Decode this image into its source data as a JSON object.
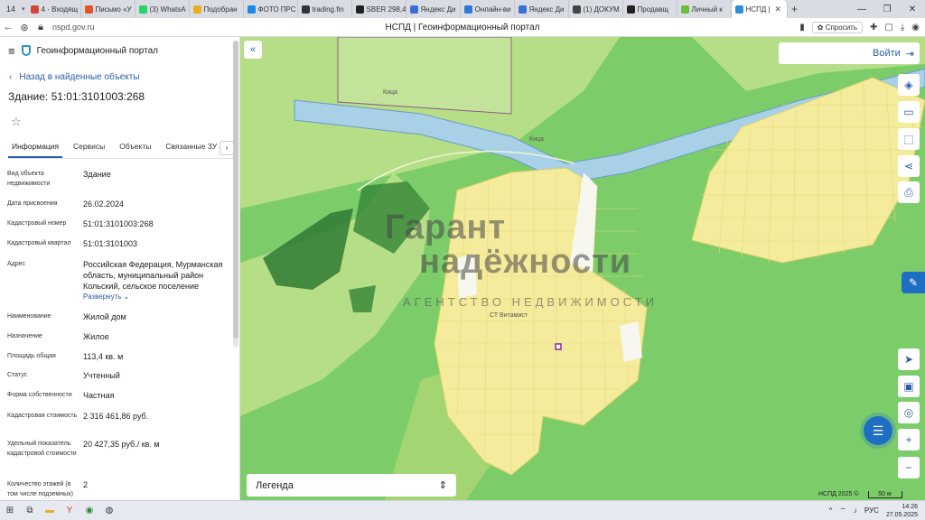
{
  "browser": {
    "tab_count": "14",
    "tabs": [
      {
        "label": "4 · Входящ",
        "color": "#d44638"
      },
      {
        "label": "Письмо «У",
        "color": "#e0552a"
      },
      {
        "label": "(3) WhatsA",
        "color": "#25d366"
      },
      {
        "label": "Подобран",
        "color": "#e8b020"
      },
      {
        "label": "ФОТО ПРС",
        "color": "#1e88e5"
      },
      {
        "label": "trading.fin",
        "color": "#333333"
      },
      {
        "label": "SBER 298,4",
        "color": "#222222"
      },
      {
        "label": "Яндекс Ди",
        "color": "#3b6fd8"
      },
      {
        "label": "Онлайн-ви",
        "color": "#2a7bd8"
      },
      {
        "label": "Яндекс Ди",
        "color": "#3b6fd8"
      },
      {
        "label": "(1) ДОКУМ",
        "color": "#444444"
      },
      {
        "label": "Продавщ",
        "color": "#222222"
      },
      {
        "label": "Личный к",
        "color": "#6cbf3c"
      },
      {
        "label": "НСПД |",
        "color": "#2a8fd8",
        "active": true
      }
    ],
    "url": "nspd.gov.ru",
    "page_title": "НСПД | Геоинформационный портал",
    "ask_label": "Спросить"
  },
  "panel": {
    "portal_title": "Геоинформационный портал",
    "back_label": "Назад в найденные объекты",
    "object_title": "Здание: 51:01:3101003:268",
    "tabs": [
      "Информация",
      "Сервисы",
      "Объекты",
      "Связанные ЗУ"
    ],
    "rows": [
      {
        "label": "Вид объекта недвижимости",
        "value": "Здание"
      },
      {
        "label": "Дата присвоения",
        "value": "26.02.2024"
      },
      {
        "label": "Кадастровый номер",
        "value": "51:01:3101003:268"
      },
      {
        "label": "Кадастровый квартал",
        "value": "51:01:3101003"
      },
      {
        "label": "Адрес",
        "value": "Российская Федерация, Мурманская область, муниципальный район Кольский, сельское поселение"
      },
      {
        "label": "Наименование",
        "value": "Жилой дом"
      },
      {
        "label": "Назначение",
        "value": "Жилое"
      },
      {
        "label": "Площадь общая",
        "value": "113,4 кв. м"
      },
      {
        "label": "Статус",
        "value": "Учтенный"
      },
      {
        "label": "Форма собственности",
        "value": "Частная"
      },
      {
        "label": "Кадастровая стоимость",
        "value": "2 316 461,86 руб."
      },
      {
        "label": "Удельный показатель кадастровой стоимости",
        "value": "20 427,35 руб./ кв. м"
      },
      {
        "label": "Количество этажей (в том числе подземных)",
        "value": "2"
      }
    ],
    "expand_label": "Развернуть"
  },
  "map": {
    "login_label": "Войти",
    "legend_label": "Легенда",
    "scale_label": "50 м",
    "copyright": "НСПД 2025 ©",
    "river_label_1": "Кица",
    "river_label_2": "Кица",
    "settlement_label": "СТ Витамист",
    "watermark": {
      "line1": "Гарант",
      "line2": "надёжности",
      "line3": "АГЕНТСТВО НЕДВИЖИМОСТИ"
    }
  },
  "taskbar": {
    "lang": "РУС",
    "time": "14:26",
    "date": "27.05.2025"
  }
}
